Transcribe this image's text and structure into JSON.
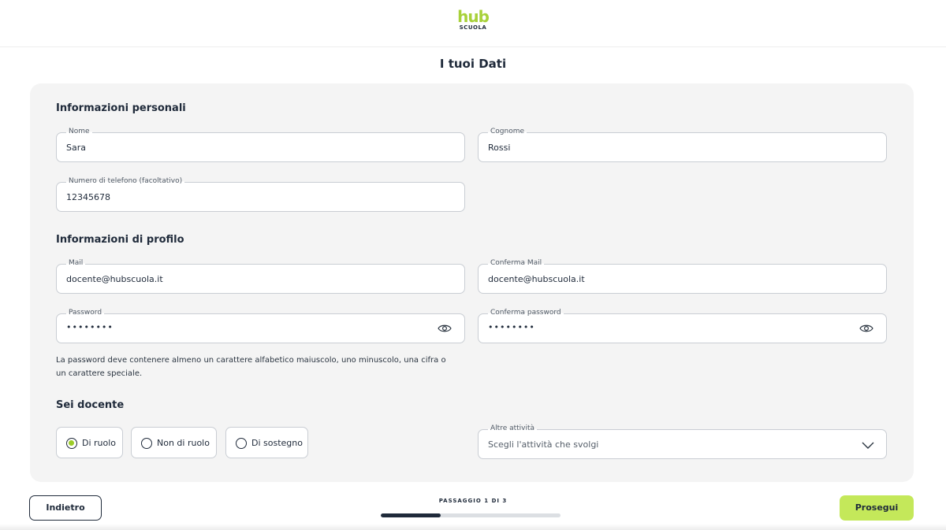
{
  "header": {
    "logo_word": "hub",
    "logo_sub": "SCUOLA"
  },
  "page": {
    "title": "I tuoi Dati"
  },
  "personal": {
    "title": "Informazioni personali",
    "nome": {
      "label": "Nome",
      "value": "Sara"
    },
    "cognome": {
      "label": "Cognome",
      "value": "Rossi"
    },
    "telefono": {
      "label": "Numero di telefono (facoltativo)",
      "value": "12345678"
    }
  },
  "profile": {
    "title": "Informazioni di profilo",
    "mail": {
      "label": "Mail",
      "value": "docente@hubscuola.it"
    },
    "conferma_mail": {
      "label": "Conferma Mail",
      "value": "docente@hubscuola.it"
    },
    "password": {
      "label": "Password",
      "value": "••••••••"
    },
    "conferma_password": {
      "label": "Conferma password",
      "value": "••••••••"
    },
    "hint_line1": "La password deve contenere almeno un carattere alfabetico maiuscolo, uno minuscolo, una cifra o",
    "hint_line2": "un carattere speciale."
  },
  "teacher": {
    "title": "Sei docente",
    "options": [
      {
        "label": "Di ruolo",
        "selected": true
      },
      {
        "label": "Non di ruolo",
        "selected": false
      },
      {
        "label": "Di sostegno",
        "selected": false
      }
    ],
    "altre": {
      "label": "Altre attività",
      "placeholder": "Scegli l'attività che svolgi"
    }
  },
  "footer": {
    "back_label": "Indietro",
    "next_label": "Prosegui",
    "step_label": "PASSAGGIO 1 DI 3",
    "progress_fraction": 0.333
  },
  "colors": {
    "accent": "#c4e85a",
    "radio_selected": "#9ccc28",
    "text_dark": "#1f2a3a",
    "logo_green": "#a8d13a"
  },
  "icons": {
    "password_toggle": "eye-icon",
    "dropdown": "chevron-down-icon"
  }
}
